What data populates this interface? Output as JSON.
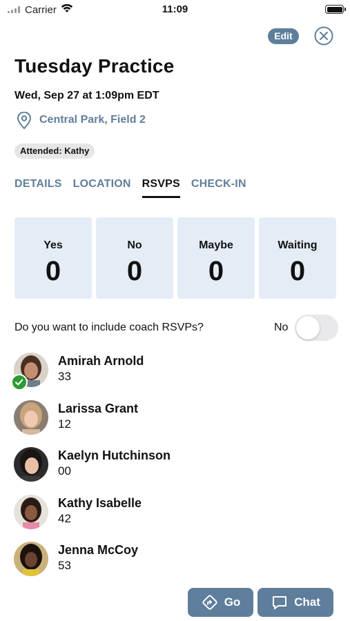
{
  "status_bar": {
    "carrier": "Carrier",
    "time": "11:09"
  },
  "header": {
    "edit_label": "Edit",
    "close_icon": "close-circle-icon"
  },
  "event": {
    "title": "Tuesday Practice",
    "datetime": "Wed, Sep 27 at 1:09pm EDT",
    "location": "Central Park, Field 2",
    "attended": "Attended: Kathy"
  },
  "tabs": [
    {
      "label": "DETAILS",
      "active": false
    },
    {
      "label": "LOCATION",
      "active": false
    },
    {
      "label": "RSVPS",
      "active": true
    },
    {
      "label": "CHECK-IN",
      "active": false
    }
  ],
  "rsvp_stats": [
    {
      "label": "Yes",
      "value": "0"
    },
    {
      "label": "No",
      "value": "0"
    },
    {
      "label": "Maybe",
      "value": "0"
    },
    {
      "label": "Waiting",
      "value": "0"
    }
  ],
  "coach_toggle": {
    "question": "Do you want to include coach RSVPs?",
    "value_label": "No",
    "on": false
  },
  "roster": [
    {
      "name": "Amirah Arnold",
      "number": "33",
      "checked_in": true
    },
    {
      "name": "Larissa Grant",
      "number": "12",
      "checked_in": false
    },
    {
      "name": "Kaelyn Hutchinson",
      "number": "00",
      "checked_in": false
    },
    {
      "name": "Kathy Isabelle",
      "number": "42",
      "checked_in": false
    },
    {
      "name": "Jenna McCoy",
      "number": "53",
      "checked_in": false
    }
  ],
  "actions": {
    "go_label": "Go",
    "chat_label": "Chat"
  },
  "colors": {
    "accent": "#5f7e9b",
    "stat_bg": "#e4edf6",
    "check_green": "#2e9b34"
  }
}
